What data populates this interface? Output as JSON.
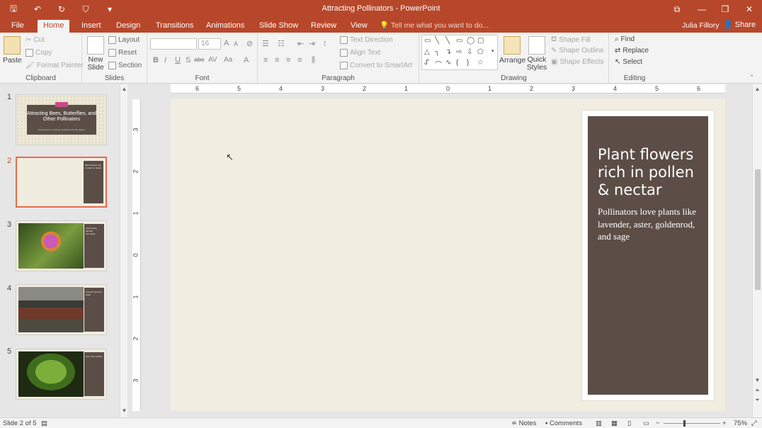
{
  "app": {
    "doc_title": "Attracting Pollinators - PowerPoint"
  },
  "quick_access": {
    "icons": [
      "save-icon",
      "undo-icon",
      "redo-icon",
      "slideshow-icon",
      "customize-icon"
    ],
    "save_glyph": "🖫",
    "undo_glyph": "↶",
    "redo_glyph": "↻",
    "present_glyph": "⛉",
    "customize_glyph": "▾"
  },
  "window_controls": {
    "ribbon_display": "⧉",
    "minimize": "—",
    "restore": "❐",
    "close": "✕"
  },
  "tabs": [
    "File",
    "Home",
    "Insert",
    "Design",
    "Transitions",
    "Animations",
    "Slide Show",
    "Review",
    "View"
  ],
  "active_tab": "Home",
  "tell_me": "Tell me what you want to do...",
  "user": "Julia Fillory",
  "share": "Share",
  "ribbon": {
    "clipboard": {
      "paste": "Paste",
      "cut": "Cut",
      "copy": "Copy",
      "format_painter": "Format Painter",
      "label": "Clipboard"
    },
    "slides": {
      "new_slide": "New Slide",
      "layout": "Layout",
      "reset": "Reset",
      "section": "Section",
      "label": "Slides"
    },
    "font": {
      "size": "16",
      "label": "Font",
      "bold": "B",
      "italic": "I",
      "underline": "U",
      "strike": "S",
      "shadow": "abc",
      "spacing": "AV",
      "case": "Aa",
      "grow": "A",
      "shrink": "A"
    },
    "paragraph": {
      "text_direction": "Text Direction",
      "align_text": "Align Text",
      "convert_smartart": "Convert to SmartArt",
      "label": "Paragraph"
    },
    "drawing": {
      "arrange": "Arrange",
      "quick_styles": "Quick Styles",
      "shape_fill": "Shape Fill",
      "shape_outline": "Shape Outline",
      "shape_effects": "Shape Effects",
      "label": "Drawing"
    },
    "editing": {
      "find": "Find",
      "replace": "Replace",
      "select": "Select",
      "label": "Editing"
    }
  },
  "slides": [
    {
      "num": "1",
      "title": "Attracting Bees, Butterflies, and Other Pollinators",
      "subtitle": "Helpful tips for creating a pollinator friendly garden"
    },
    {
      "num": "2",
      "title": "Plant flowers rich in pollen & nectar",
      "body": "Pollinators love plants like lavender, aster, goldenrod, and sage"
    },
    {
      "num": "3",
      "title": "Avoid using harmful chemicals",
      "body": "Pesticides can harm pollinators"
    },
    {
      "num": "4",
      "title": "Provide food and water",
      "body": "A shallow dish of water with pebbles helps"
    },
    {
      "num": "5",
      "title": "Give them shelter",
      "body": "Leave some areas of your garden wild"
    }
  ],
  "current_slide": {
    "title": "Plant flowers rich in pollen & nectar",
    "body": "Pollinators love plants like lavender, aster, goldenrod, and sage"
  },
  "ruler": {
    "h": [
      "6",
      "5",
      "4",
      "3",
      "2",
      "1",
      "0",
      "1",
      "2",
      "3",
      "4",
      "5",
      "6"
    ],
    "v": [
      "3",
      "2",
      "1",
      "0",
      "1",
      "2",
      "3"
    ]
  },
  "status": {
    "slide_of": "Slide 2 of 5",
    "notes": "Notes",
    "comments": "Comments",
    "zoom": "75%"
  },
  "colors": {
    "accent": "#b7472a",
    "panel": "#5c4e47",
    "slide_bg": "#f1ede1"
  }
}
